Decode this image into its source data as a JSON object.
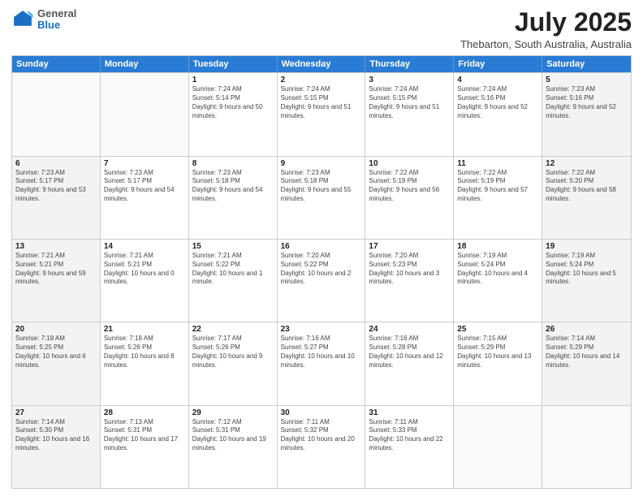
{
  "header": {
    "logo": {
      "general": "General",
      "blue": "Blue"
    },
    "title": "July 2025",
    "subtitle": "Thebarton, South Australia, Australia"
  },
  "calendar": {
    "days_of_week": [
      "Sunday",
      "Monday",
      "Tuesday",
      "Wednesday",
      "Thursday",
      "Friday",
      "Saturday"
    ],
    "weeks": [
      [
        {
          "day": "",
          "empty": true
        },
        {
          "day": "",
          "empty": true
        },
        {
          "day": "1",
          "sunrise": "7:24 AM",
          "sunset": "5:14 PM",
          "daylight": "9 hours and 50 minutes."
        },
        {
          "day": "2",
          "sunrise": "7:24 AM",
          "sunset": "5:15 PM",
          "daylight": "9 hours and 51 minutes."
        },
        {
          "day": "3",
          "sunrise": "7:24 AM",
          "sunset": "5:15 PM",
          "daylight": "9 hours and 51 minutes."
        },
        {
          "day": "4",
          "sunrise": "7:24 AM",
          "sunset": "5:16 PM",
          "daylight": "9 hours and 52 minutes."
        },
        {
          "day": "5",
          "sunrise": "7:23 AM",
          "sunset": "5:16 PM",
          "daylight": "9 hours and 52 minutes."
        }
      ],
      [
        {
          "day": "6",
          "sunrise": "7:23 AM",
          "sunset": "5:17 PM",
          "daylight": "9 hours and 53 minutes."
        },
        {
          "day": "7",
          "sunrise": "7:23 AM",
          "sunset": "5:17 PM",
          "daylight": "9 hours and 54 minutes."
        },
        {
          "day": "8",
          "sunrise": "7:23 AM",
          "sunset": "5:18 PM",
          "daylight": "9 hours and 54 minutes."
        },
        {
          "day": "9",
          "sunrise": "7:23 AM",
          "sunset": "5:18 PM",
          "daylight": "9 hours and 55 minutes."
        },
        {
          "day": "10",
          "sunrise": "7:22 AM",
          "sunset": "5:19 PM",
          "daylight": "9 hours and 56 minutes."
        },
        {
          "day": "11",
          "sunrise": "7:22 AM",
          "sunset": "5:19 PM",
          "daylight": "9 hours and 57 minutes."
        },
        {
          "day": "12",
          "sunrise": "7:22 AM",
          "sunset": "5:20 PM",
          "daylight": "9 hours and 58 minutes."
        }
      ],
      [
        {
          "day": "13",
          "sunrise": "7:21 AM",
          "sunset": "5:21 PM",
          "daylight": "9 hours and 59 minutes."
        },
        {
          "day": "14",
          "sunrise": "7:21 AM",
          "sunset": "5:21 PM",
          "daylight": "10 hours and 0 minutes."
        },
        {
          "day": "15",
          "sunrise": "7:21 AM",
          "sunset": "5:22 PM",
          "daylight": "10 hours and 1 minute."
        },
        {
          "day": "16",
          "sunrise": "7:20 AM",
          "sunset": "5:22 PM",
          "daylight": "10 hours and 2 minutes."
        },
        {
          "day": "17",
          "sunrise": "7:20 AM",
          "sunset": "5:23 PM",
          "daylight": "10 hours and 3 minutes."
        },
        {
          "day": "18",
          "sunrise": "7:19 AM",
          "sunset": "5:24 PM",
          "daylight": "10 hours and 4 minutes."
        },
        {
          "day": "19",
          "sunrise": "7:19 AM",
          "sunset": "5:24 PM",
          "daylight": "10 hours and 5 minutes."
        }
      ],
      [
        {
          "day": "20",
          "sunrise": "7:18 AM",
          "sunset": "5:25 PM",
          "daylight": "10 hours and 6 minutes."
        },
        {
          "day": "21",
          "sunrise": "7:18 AM",
          "sunset": "5:26 PM",
          "daylight": "10 hours and 8 minutes."
        },
        {
          "day": "22",
          "sunrise": "7:17 AM",
          "sunset": "5:26 PM",
          "daylight": "10 hours and 9 minutes."
        },
        {
          "day": "23",
          "sunrise": "7:16 AM",
          "sunset": "5:27 PM",
          "daylight": "10 hours and 10 minutes."
        },
        {
          "day": "24",
          "sunrise": "7:16 AM",
          "sunset": "5:28 PM",
          "daylight": "10 hours and 12 minutes."
        },
        {
          "day": "25",
          "sunrise": "7:15 AM",
          "sunset": "5:29 PM",
          "daylight": "10 hours and 13 minutes."
        },
        {
          "day": "26",
          "sunrise": "7:14 AM",
          "sunset": "5:29 PM",
          "daylight": "10 hours and 14 minutes."
        }
      ],
      [
        {
          "day": "27",
          "sunrise": "7:14 AM",
          "sunset": "5:30 PM",
          "daylight": "10 hours and 16 minutes."
        },
        {
          "day": "28",
          "sunrise": "7:13 AM",
          "sunset": "5:31 PM",
          "daylight": "10 hours and 17 minutes."
        },
        {
          "day": "29",
          "sunrise": "7:12 AM",
          "sunset": "5:31 PM",
          "daylight": "10 hours and 19 minutes."
        },
        {
          "day": "30",
          "sunrise": "7:11 AM",
          "sunset": "5:32 PM",
          "daylight": "10 hours and 20 minutes."
        },
        {
          "day": "31",
          "sunrise": "7:11 AM",
          "sunset": "5:33 PM",
          "daylight": "10 hours and 22 minutes."
        },
        {
          "day": "",
          "empty": true
        },
        {
          "day": "",
          "empty": true
        }
      ]
    ]
  }
}
